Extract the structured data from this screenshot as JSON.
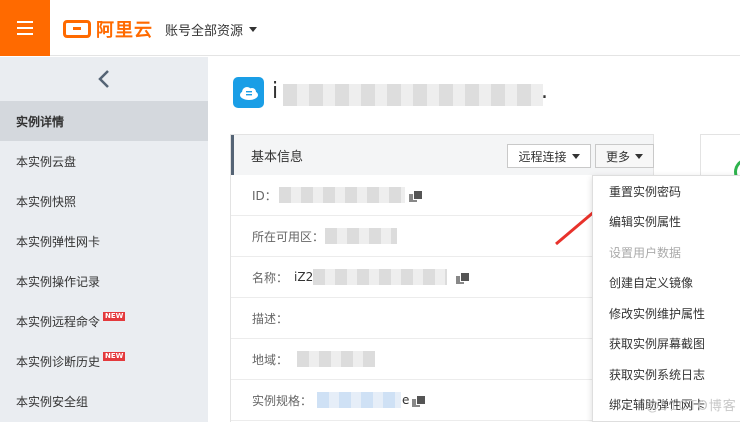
{
  "topbar": {
    "logo_text": "阿里云",
    "account_label": "账号全部资源"
  },
  "sidebar": {
    "items": [
      {
        "label": "实例详情",
        "active": true,
        "new": false
      },
      {
        "label": "本实例云盘",
        "active": false,
        "new": false
      },
      {
        "label": "本实例快照",
        "active": false,
        "new": false
      },
      {
        "label": "本实例弹性网卡",
        "active": false,
        "new": false
      },
      {
        "label": "本实例操作记录",
        "active": false,
        "new": false
      },
      {
        "label": "本实例远程命令",
        "active": false,
        "new": true
      },
      {
        "label": "本实例诊断历史",
        "active": false,
        "new": true
      },
      {
        "label": "本实例安全组",
        "active": false,
        "new": false
      }
    ],
    "new_badge": "NEW"
  },
  "instance": {
    "title_prefix": "i",
    "title_suffix": "."
  },
  "basic_info": {
    "title": "基本信息",
    "remote_connect_label": "远程连接",
    "more_label": "更多",
    "rows": [
      {
        "label": "ID："
      },
      {
        "label": "所在可用区："
      },
      {
        "label": "名称：",
        "value_prefix": "iZ2"
      },
      {
        "label": "描述："
      },
      {
        "label": "地域："
      },
      {
        "label": "实例规格：",
        "value_suffix": "e"
      }
    ]
  },
  "more_menu": {
    "items": [
      {
        "label": "重置实例密码",
        "disabled": false
      },
      {
        "label": "编辑实例属性",
        "disabled": false
      },
      {
        "label": "设置用户数据",
        "disabled": true
      },
      {
        "label": "创建自定义镜像",
        "disabled": false
      },
      {
        "label": "修改实例维护属性",
        "disabled": false
      },
      {
        "label": "获取实例屏幕截图",
        "disabled": false
      },
      {
        "label": "获取实例系统日志",
        "disabled": false
      },
      {
        "label": "绑定辅助弹性网卡",
        "disabled": false
      }
    ]
  },
  "watermark": "@51CTO博客",
  "colors": {
    "brand": "#ff6a00",
    "annotation_arrow": "#e8322b",
    "cloud_icon": "#1a9ee6"
  }
}
